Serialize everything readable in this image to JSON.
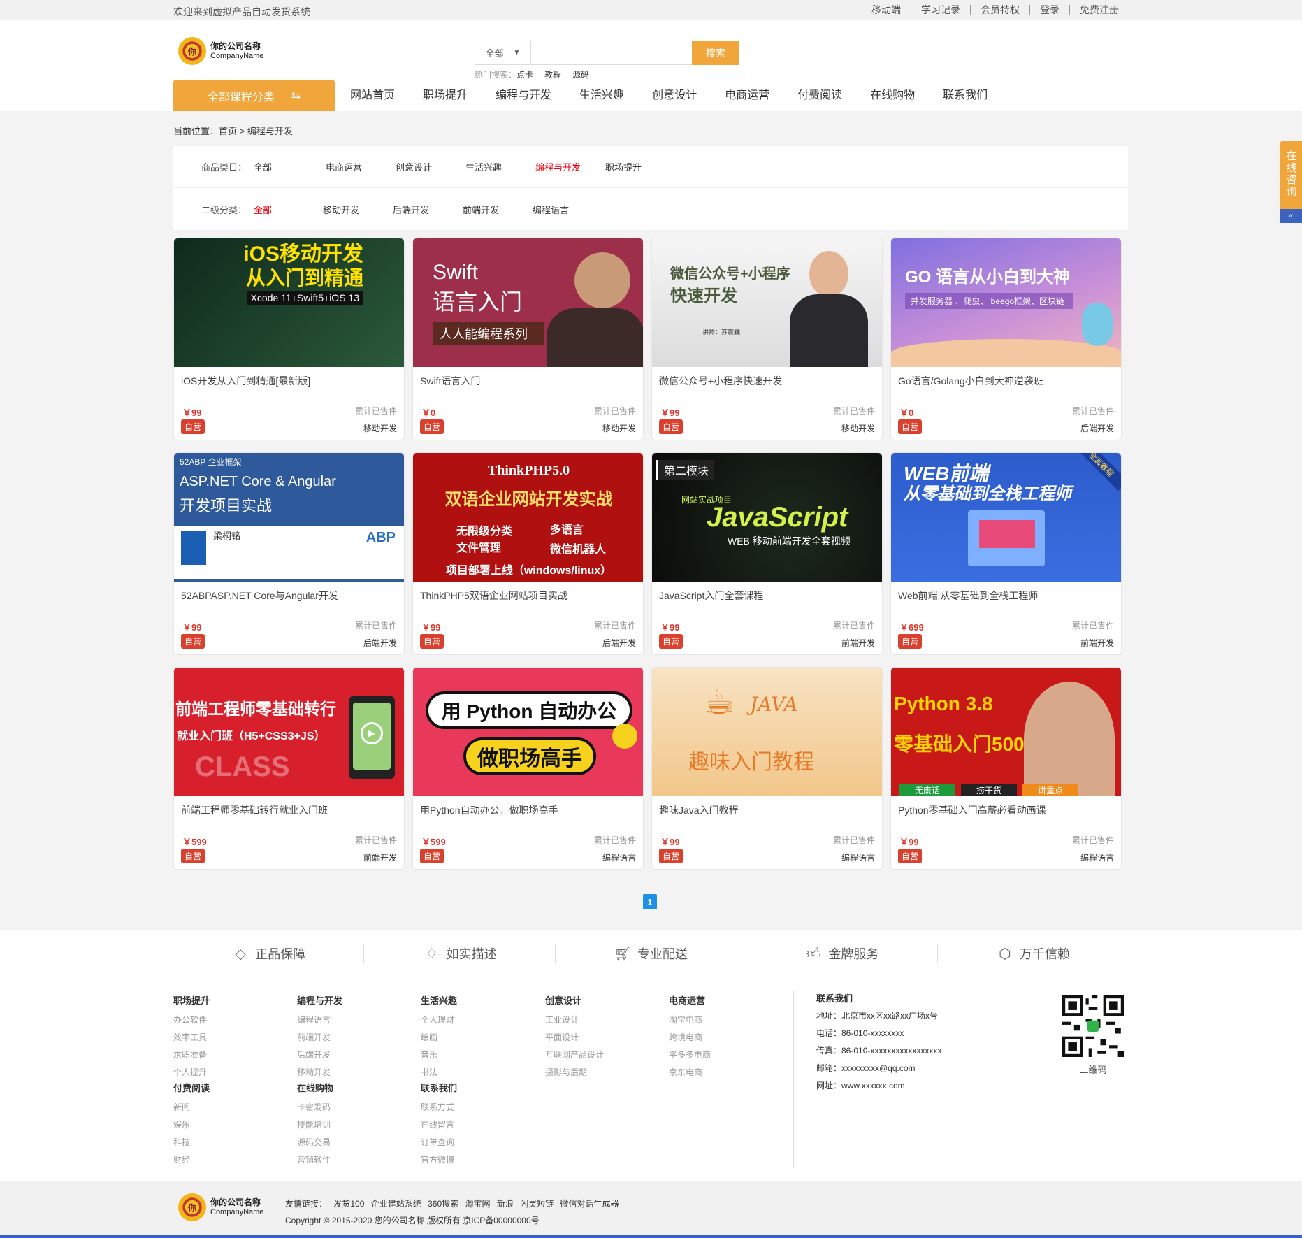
{
  "topbar": {
    "welcome": "欢迎来到虚拟产品自动发货系统",
    "links": [
      "移动端",
      "学习记录",
      "会员特权",
      "登录",
      "免费注册"
    ]
  },
  "logo": {
    "seal_text": "你",
    "name": "你的公司名称",
    "name_en": "CompanyName"
  },
  "search": {
    "select_value": "全部",
    "placeholder": "",
    "button": "搜索",
    "hot_label": "热门搜索：",
    "hot_items": [
      "点卡",
      "教程",
      "源码"
    ]
  },
  "nav": {
    "all_categories": "全部课程分类",
    "items": [
      "网站首页",
      "职场提升",
      "编程与开发",
      "生活兴趣",
      "创意设计",
      "电商运营",
      "付费阅读",
      "在线购物",
      "联系我们"
    ]
  },
  "breadcrumb": {
    "label": "当前位置：",
    "home": "首页",
    "sep": ">",
    "current": "编程与开发"
  },
  "filter": {
    "row1_label": "商品类目：",
    "row1_items": [
      "全部",
      "电商运营",
      "创意设计",
      "生活兴趣",
      "编程与开发",
      "职场提升"
    ],
    "row1_active": "编程与开发",
    "row2_label": "二级分类：",
    "row2_items": [
      "全部",
      "移动开发",
      "后端开发",
      "前端开发",
      "编程语言"
    ],
    "row2_active": "全部"
  },
  "products": [
    {
      "title": "iOS开发从入门到精通[最新版]",
      "price": "￥99",
      "sold": "累计已售件",
      "tag": "自营",
      "category": "移动开发",
      "img_lines": [
        "iOS移动开发",
        "从入门到精通",
        "Xcode 11+Swift5+iOS 13"
      ],
      "bg": "#1f3a2a"
    },
    {
      "title": "Swift语言入门",
      "price": "￥0",
      "sold": "累计已售件",
      "tag": "自营",
      "category": "移动开发",
      "img_lines": [
        "Swift",
        "语言入门",
        "人人能编程系列"
      ],
      "bg": "#9e2f4a"
    },
    {
      "title": "微信公众号+小程序快速开发",
      "price": "￥99",
      "sold": "累计已售件",
      "tag": "自营",
      "category": "移动开发",
      "img_lines": [
        "微信公众号+小程序",
        "快速开发",
        "讲师：苏震巍"
      ],
      "bg": "#eeeeee"
    },
    {
      "title": "Go语言/Golang小白到大神逆袭班",
      "price": "￥0",
      "sold": "累计已售件",
      "tag": "自营",
      "category": "后端开发",
      "img_lines": [
        "GO 语言从小白到大神",
        "并发服务器 、爬虫、 beego框架、区块链"
      ],
      "bg": "#8a6fd6"
    },
    {
      "title": "52ABPASP.NET Core与Angular开发",
      "price": "￥99",
      "sold": "累计已售件",
      "tag": "自营",
      "category": "后端开发",
      "img_lines": [
        "52ABP 企业框架",
        "ASP.NET Core & Angular",
        "开发项目实战",
        "梁桐铭",
        "ABP"
      ],
      "bg": "#2e5a9c"
    },
    {
      "title": "ThinkPHP5双语企业网站项目实战",
      "price": "￥99",
      "sold": "累计已售件",
      "tag": "自营",
      "category": "后端开发",
      "img_lines": [
        "ThinkPHP5.0",
        "双语企业网站开发实战",
        "无限级分类",
        "多语言",
        "文件管理",
        "微信机器人",
        "项目部署上线（windows/linux）"
      ],
      "bg": "#b01010"
    },
    {
      "title": "JavaScript入门全套课程",
      "price": "￥99",
      "sold": "累计已售件",
      "tag": "自营",
      "category": "前端开发",
      "img_lines": [
        "第二模块",
        "网站实战项目",
        "JavaScript",
        "WEB 移动前端开发全套视频"
      ],
      "bg": "#111111"
    },
    {
      "title": "Web前端,从零基础到全栈工程师",
      "price": "￥699",
      "sold": "累计已售件",
      "tag": "自营",
      "category": "前端开发",
      "img_lines": [
        "WEB前端",
        "从零基础到全栈工程师",
        "全套教程"
      ],
      "bg": "#2f5fc8"
    },
    {
      "title": "前端工程师零基础转行就业入门班",
      "price": "￥599",
      "sold": "累计已售件",
      "tag": "自营",
      "category": "前端开发",
      "img_lines": [
        "前端工程师零基础转行",
        "就业入门班（H5+CSS3+JS）",
        "CLASS"
      ],
      "bg": "#d8202c"
    },
    {
      "title": "用Python自动办公，做职场高手",
      "price": "￥599",
      "sold": "累计已售件",
      "tag": "自营",
      "category": "编程语言",
      "img_lines": [
        "用 Python 自动办公",
        "做职场高手"
      ],
      "bg": "#e8395a"
    },
    {
      "title": "趣味Java入门教程",
      "price": "￥99",
      "sold": "累计已售件",
      "tag": "自营",
      "category": "编程语言",
      "img_lines": [
        "JAVA",
        "趣味入门教程"
      ],
      "bg": "#f6d8a8"
    },
    {
      "title": "Python零基础入门高薪必看动画课",
      "price": "￥99",
      "sold": "累计已售件",
      "tag": "自营",
      "category": "编程语言",
      "img_lines": [
        "Python 3.8",
        "零基础入门500集",
        "无废话",
        "捞干货",
        "讲重点"
      ],
      "bg": "#c81818"
    }
  ],
  "pagination": {
    "current": "1"
  },
  "guarantees": [
    "正品保障",
    "如实描述",
    "专业配送",
    "金牌服务",
    "万千信赖"
  ],
  "footer_cols": [
    {
      "title": "职场提升",
      "items": [
        "办公软件",
        "效率工具",
        "求职准备",
        "个人提升"
      ]
    },
    {
      "title": "编程与开发",
      "items": [
        "编程语言",
        "前端开发",
        "后端开发",
        "移动开发"
      ]
    },
    {
      "title": "生活兴趣",
      "items": [
        "个人理财",
        "绘画",
        "音乐",
        "书法"
      ]
    },
    {
      "title": "创意设计",
      "items": [
        "工业设计",
        "平面设计",
        "互联网产品设计",
        "摄影与后期"
      ]
    },
    {
      "title": "电商运营",
      "items": [
        "淘宝电商",
        "跨境电商",
        "平多多电商",
        "京东电商"
      ]
    },
    {
      "title": "付费阅读",
      "items": [
        "新闻",
        "娱乐",
        "科技",
        "财经"
      ]
    },
    {
      "title": "在线购物",
      "items": [
        "卡密发码",
        "技能培训",
        "源码交易",
        "营销软件"
      ]
    },
    {
      "title": "联系我们",
      "items": [
        "联系方式",
        "在线留言",
        "订单查询",
        "官方微博"
      ]
    }
  ],
  "contact": {
    "title": "联系我们",
    "lines": [
      "地址：北京市xx区xx路xx广场x号",
      "电话：86-010-xxxxxxxx",
      "传真：86-010-xxxxxxxxxxxxxxxxx",
      "邮箱：xxxxxxxxx@qq.com",
      "网址：www.xxxxxx.com"
    ],
    "qr_label": "二维码"
  },
  "bottom": {
    "links_label": "友情链接：",
    "links": [
      "发货100",
      "企业建站系统",
      "360搜索",
      "淘宝网",
      "新浪",
      "闪灵短链",
      "微信对话生成器"
    ],
    "copyright": "Copyright © 2015-2020 您的公司名称 版权所有 京ICP备00000000号"
  },
  "float_service": "在线咨询",
  "colors": {
    "accent": "#f0a63a",
    "active_red": "#e60012",
    "price": "#e0352b",
    "tag": "#d9402e",
    "pager": "#1e90e8"
  }
}
